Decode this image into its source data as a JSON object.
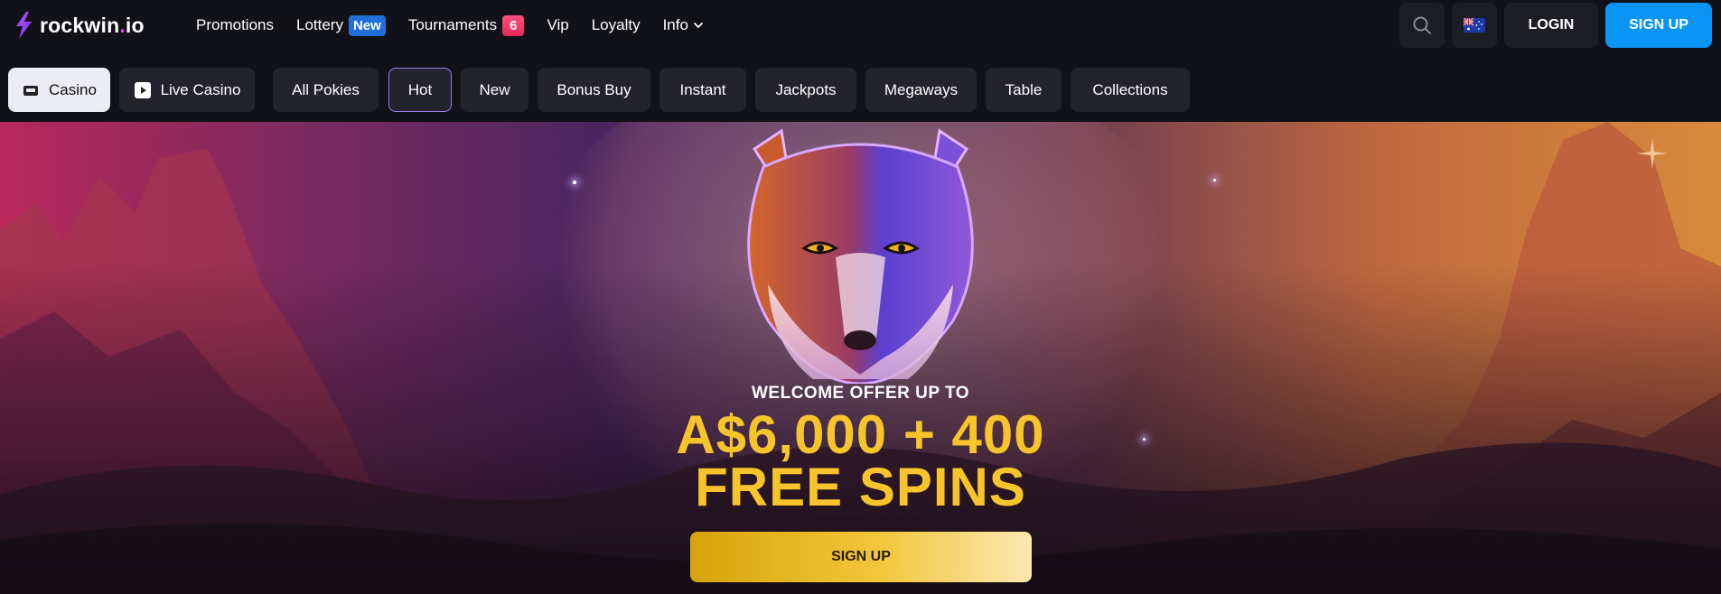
{
  "brand": {
    "name_main": "rockwin",
    "name_dot": ".",
    "name_tld": "io"
  },
  "nav": {
    "promotions": "Promotions",
    "lottery": "Lottery",
    "lottery_badge": "New",
    "tournaments": "Tournaments",
    "tournaments_badge": "6",
    "vip": "Vip",
    "loyalty": "Loyalty",
    "info": "Info"
  },
  "header": {
    "login": "LOGIN",
    "signup": "SIGN UP",
    "search_icon": "search-icon",
    "flag_icon": "australia-flag-icon"
  },
  "categories": {
    "casino": "Casino",
    "live_casino": "Live Casino",
    "all_pokies": "All Pokies",
    "hot": "Hot",
    "new": "New",
    "bonus_buy": "Bonus Buy",
    "instant": "Instant",
    "jackpots": "Jackpots",
    "megaways": "Megaways",
    "table": "Table",
    "collections": "Collections"
  },
  "hero": {
    "subtitle": "WELCOME OFFER UP TO",
    "line1": "A$6,000 + 400",
    "line2": "FREE SPINS",
    "cta": "SIGN UP"
  },
  "colors": {
    "accent_blue": "#0a95f5",
    "offer_yellow": "#f7c52b",
    "badge_new": "#1f6fd6",
    "badge_count": "#e8295c"
  }
}
